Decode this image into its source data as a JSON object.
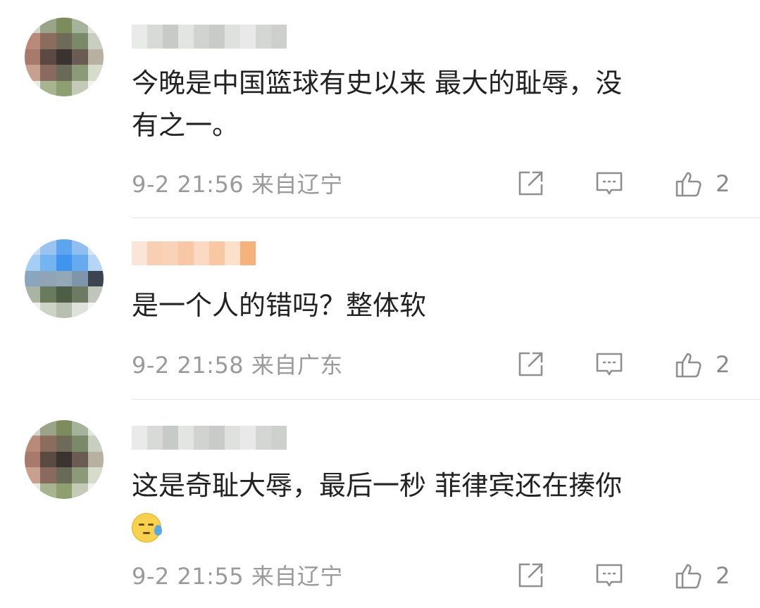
{
  "comments": [
    {
      "text_line1": "今晚是中国篮球有史以来 最大的耻辱，没",
      "text_line2": "有之一。",
      "time": "9-2 21:56",
      "location": "来自辽宁",
      "likes": "2"
    },
    {
      "text_line1": "是一个人的错吗？整体软",
      "time": "9-2 21:58",
      "location": "来自广东",
      "likes": "2"
    },
    {
      "text_line1": "这是奇耻大辱，最后一秒 菲律宾还在揍你",
      "emoji": "sweat-emoji",
      "time": "9-2 21:55",
      "location": "来自辽宁",
      "likes": "2"
    }
  ],
  "icons": {
    "share": "share-icon",
    "reply": "comment-icon",
    "like": "thumbs-up-icon"
  },
  "colors": {
    "meta": "#9a9a9a",
    "divider": "#e6e6e6",
    "text": "#222222"
  }
}
